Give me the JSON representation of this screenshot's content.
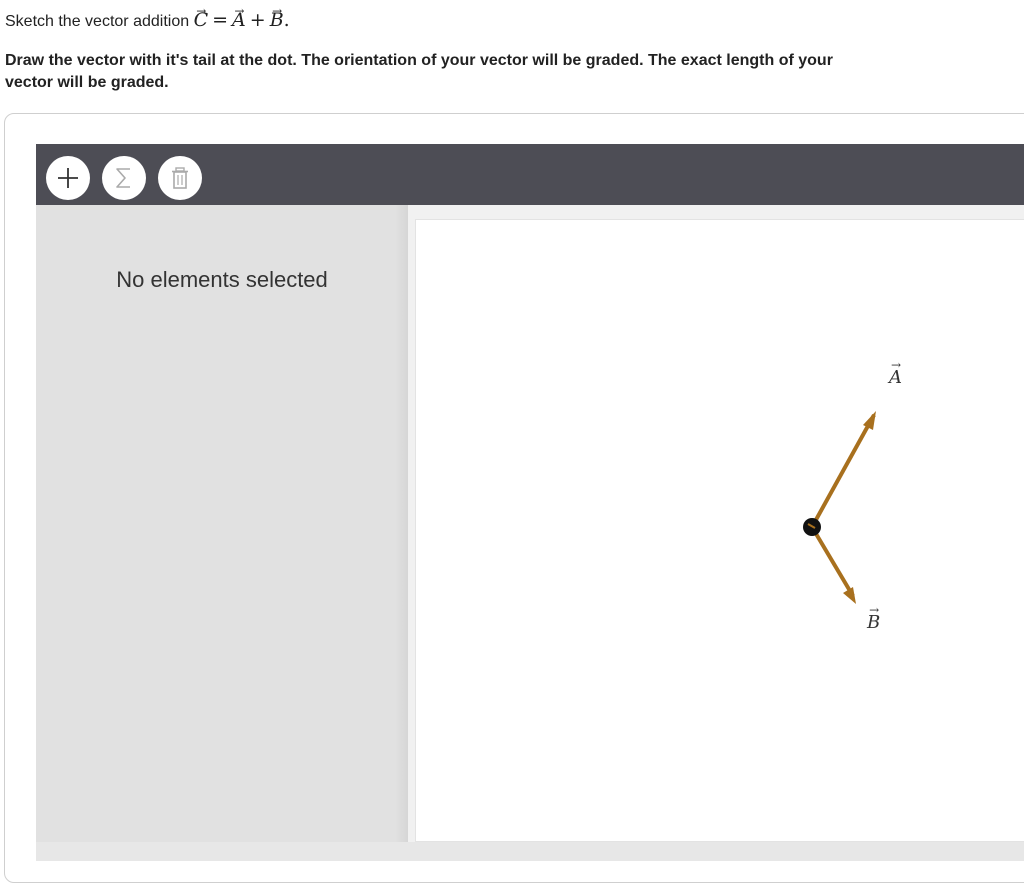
{
  "question": {
    "text_prefix": "Sketch the vector addition",
    "equation": {
      "lhs": "C",
      "eq": "=",
      "term1": "A",
      "plus": "+",
      "term2": "B",
      "end": "."
    },
    "instructions": "Draw the vector with it's tail at the dot. The orientation of your vector will be graded. The exact length of your vector will be graded."
  },
  "toolbar": {
    "buttons": [
      {
        "icon": "plus-icon"
      },
      {
        "icon": "sigma-icon"
      },
      {
        "icon": "trash-icon"
      }
    ]
  },
  "sidebar": {
    "empty_message": "No elements selected"
  },
  "canvas": {
    "vectors": [
      {
        "label": "A",
        "color": "#a8701e"
      },
      {
        "label": "B",
        "color": "#a8701e"
      }
    ],
    "dot_color": "#111111"
  }
}
